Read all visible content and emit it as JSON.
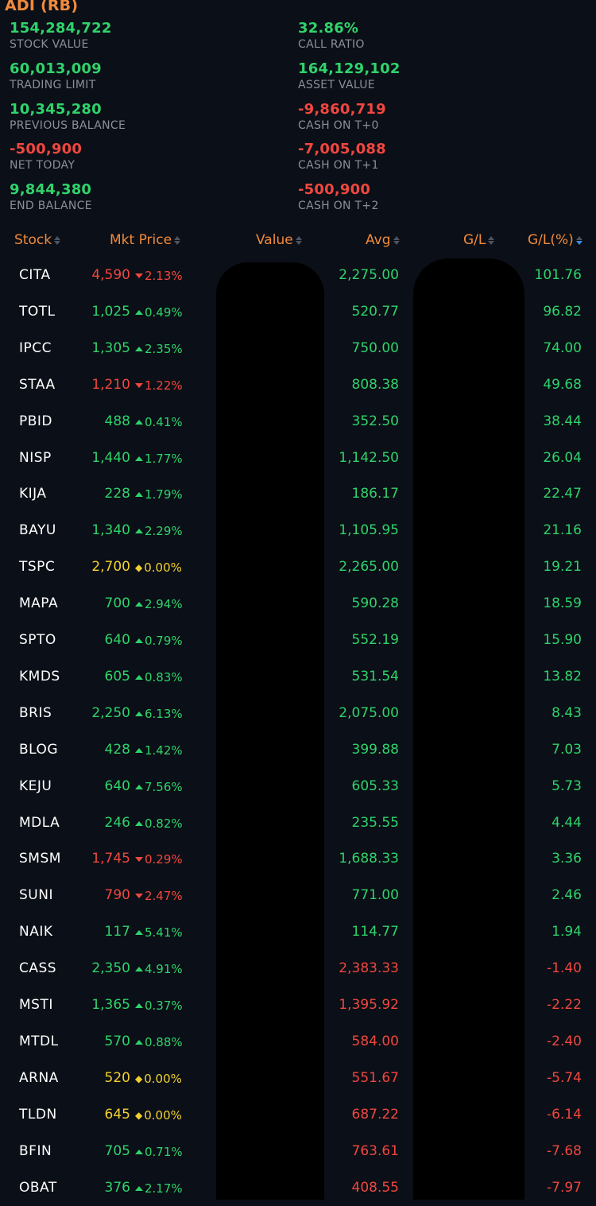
{
  "account": {
    "name": "ADI (RB)"
  },
  "summary": {
    "left": [
      {
        "value": "154,284,722",
        "label": "STOCK VALUE",
        "tone": "pos"
      },
      {
        "value": "60,013,009",
        "label": "TRADING LIMIT",
        "tone": "pos"
      },
      {
        "value": "10,345,280",
        "label": "PREVIOUS BALANCE",
        "tone": "pos"
      },
      {
        "value": "-500,900",
        "label": "NET TODAY",
        "tone": "neg"
      },
      {
        "value": "9,844,380",
        "label": "END BALANCE",
        "tone": "pos"
      }
    ],
    "right": [
      {
        "value": "32.86%",
        "label": "CALL RATIO",
        "tone": "pos"
      },
      {
        "value": "164,129,102",
        "label": "ASSET VALUE",
        "tone": "pos"
      },
      {
        "value": "-9,860,719",
        "label": "CASH ON T+0",
        "tone": "neg"
      },
      {
        "value": "-7,005,088",
        "label": "CASH ON T+1",
        "tone": "neg"
      },
      {
        "value": "-500,900",
        "label": "CASH ON T+2",
        "tone": "neg"
      }
    ]
  },
  "table": {
    "headers": {
      "stock": "Stock",
      "price": "Mkt Price",
      "value": "Value",
      "avg": "Avg",
      "gl": "G/L",
      "glpct": "G/L(%)"
    },
    "rows": [
      {
        "stock": "CITA",
        "price": "4,590",
        "change": "2.13%",
        "dir": "down",
        "avg": "2,275.00",
        "glpct": "101.76"
      },
      {
        "stock": "TOTL",
        "price": "1,025",
        "change": "0.49%",
        "dir": "up",
        "avg": "520.77",
        "glpct": "96.82"
      },
      {
        "stock": "IPCC",
        "price": "1,305",
        "change": "2.35%",
        "dir": "up",
        "avg": "750.00",
        "glpct": "74.00"
      },
      {
        "stock": "STAA",
        "price": "1,210",
        "change": "1.22%",
        "dir": "down",
        "avg": "808.38",
        "glpct": "49.68"
      },
      {
        "stock": "PBID",
        "price": "488",
        "change": "0.41%",
        "dir": "up",
        "avg": "352.50",
        "glpct": "38.44"
      },
      {
        "stock": "NISP",
        "price": "1,440",
        "change": "1.77%",
        "dir": "up",
        "avg": "1,142.50",
        "glpct": "26.04"
      },
      {
        "stock": "KIJA",
        "price": "228",
        "change": "1.79%",
        "dir": "up",
        "avg": "186.17",
        "glpct": "22.47"
      },
      {
        "stock": "BAYU",
        "price": "1,340",
        "change": "2.29%",
        "dir": "up",
        "avg": "1,105.95",
        "glpct": "21.16"
      },
      {
        "stock": "TSPC",
        "price": "2,700",
        "change": "0.00%",
        "dir": "flat",
        "avg": "2,265.00",
        "glpct": "19.21"
      },
      {
        "stock": "MAPA",
        "price": "700",
        "change": "2.94%",
        "dir": "up",
        "avg": "590.28",
        "glpct": "18.59"
      },
      {
        "stock": "SPTO",
        "price": "640",
        "change": "0.79%",
        "dir": "up",
        "avg": "552.19",
        "glpct": "15.90"
      },
      {
        "stock": "KMDS",
        "price": "605",
        "change": "0.83%",
        "dir": "up",
        "avg": "531.54",
        "glpct": "13.82"
      },
      {
        "stock": "BRIS",
        "price": "2,250",
        "change": "6.13%",
        "dir": "up",
        "avg": "2,075.00",
        "glpct": "8.43"
      },
      {
        "stock": "BLOG",
        "price": "428",
        "change": "1.42%",
        "dir": "up",
        "avg": "399.88",
        "glpct": "7.03"
      },
      {
        "stock": "KEJU",
        "price": "640",
        "change": "7.56%",
        "dir": "up",
        "avg": "605.33",
        "glpct": "5.73"
      },
      {
        "stock": "MDLA",
        "price": "246",
        "change": "0.82%",
        "dir": "up",
        "avg": "235.55",
        "glpct": "4.44"
      },
      {
        "stock": "SMSM",
        "price": "1,745",
        "change": "0.29%",
        "dir": "down",
        "avg": "1,688.33",
        "glpct": "3.36"
      },
      {
        "stock": "SUNI",
        "price": "790",
        "change": "2.47%",
        "dir": "down",
        "avg": "771.00",
        "glpct": "2.46"
      },
      {
        "stock": "NAIK",
        "price": "117",
        "change": "5.41%",
        "dir": "up",
        "avg": "114.77",
        "glpct": "1.94"
      },
      {
        "stock": "CASS",
        "price": "2,350",
        "change": "4.91%",
        "dir": "up",
        "avg": "2,383.33",
        "glpct": "-1.40"
      },
      {
        "stock": "MSTI",
        "price": "1,365",
        "change": "0.37%",
        "dir": "up",
        "avg": "1,395.92",
        "glpct": "-2.22"
      },
      {
        "stock": "MTDL",
        "price": "570",
        "change": "0.88%",
        "dir": "up",
        "avg": "584.00",
        "glpct": "-2.40"
      },
      {
        "stock": "ARNA",
        "price": "520",
        "change": "0.00%",
        "dir": "flat",
        "avg": "551.67",
        "glpct": "-5.74"
      },
      {
        "stock": "TLDN",
        "price": "645",
        "change": "0.00%",
        "dir": "flat",
        "avg": "687.22",
        "glpct": "-6.14"
      },
      {
        "stock": "BFIN",
        "price": "705",
        "change": "0.71%",
        "dir": "up",
        "avg": "763.61",
        "glpct": "-7.68"
      },
      {
        "stock": "OBAT",
        "price": "376",
        "change": "2.17%",
        "dir": "up",
        "avg": "408.55",
        "glpct": "-7.97"
      }
    ]
  },
  "colors": {
    "accent": "#f08a3c",
    "positive": "#2fd36b",
    "negative": "#f0473f",
    "neutral": "#f0d030",
    "background": "#0b0f17",
    "sort_active": "#3a8ee6"
  },
  "icons": {
    "sort": "sort-updown-icon",
    "sort_active": "sort-desc-icon",
    "up": "triangle-up-icon",
    "down": "triangle-down-icon",
    "flat": "diamond-icon"
  }
}
